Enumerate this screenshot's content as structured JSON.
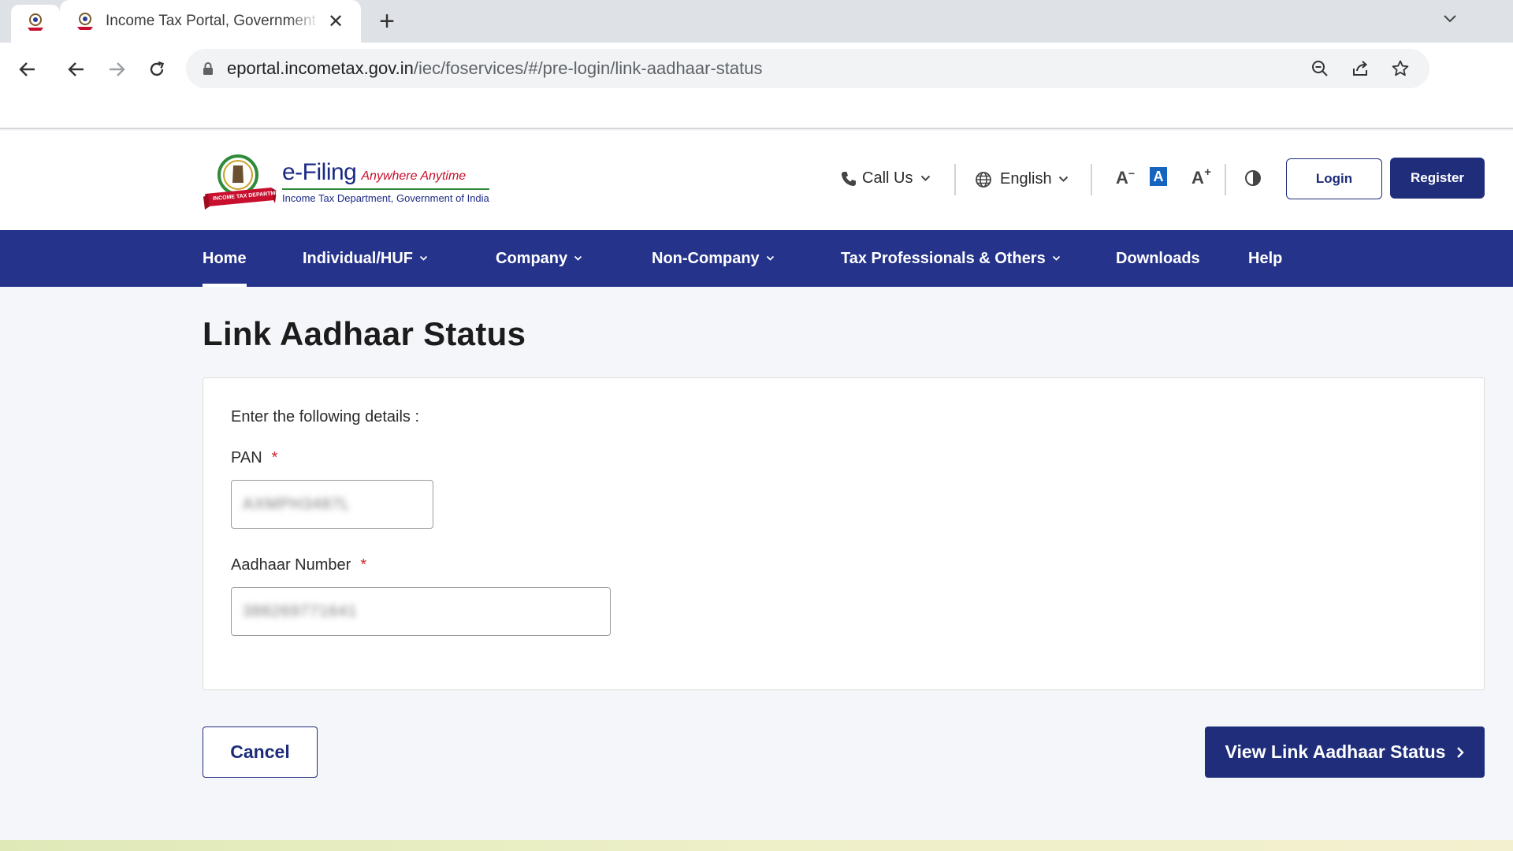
{
  "browser": {
    "tab_title": "Income Tax Portal, Government of India",
    "url_host": "eportal.incometax.gov.in",
    "url_path": "/iec/foservices/#/pre-login/link-aadhaar-status"
  },
  "header": {
    "brand_name": "e-Filing",
    "brand_tagline": "Anywhere Anytime",
    "brand_sub": "Income Tax Department, Government of India",
    "emblem_ribbon": "INCOME TAX DEPARTMENT",
    "call_us": "Call Us",
    "language": "English",
    "font_decrease": "A",
    "font_default": "A",
    "font_increase": "A",
    "login": "Login",
    "register": "Register"
  },
  "nav": {
    "items": [
      {
        "label": "Home",
        "active": true
      },
      {
        "label": "Individual/HUF",
        "dropdown": true
      },
      {
        "label": "Company",
        "dropdown": true
      },
      {
        "label": "Non-Company",
        "dropdown": true
      },
      {
        "label": "Tax Professionals & Others",
        "dropdown": true
      },
      {
        "label": "Downloads"
      },
      {
        "label": "Help"
      }
    ]
  },
  "page": {
    "title": "Link Aadhaar Status",
    "instructions": "Enter the following details :",
    "pan_label": "PAN",
    "pan_value": "AXMPH3487L",
    "aadhaar_label": "Aadhaar Number",
    "aadhaar_value": "388269771641",
    "required_mark": "*",
    "cancel": "Cancel",
    "view": "View Link Aadhaar Status"
  },
  "colors": {
    "nav_bg": "#25338a",
    "primary_button": "#1f2d7b",
    "required": "#d0262c",
    "accent_blue": "#1565c0"
  }
}
